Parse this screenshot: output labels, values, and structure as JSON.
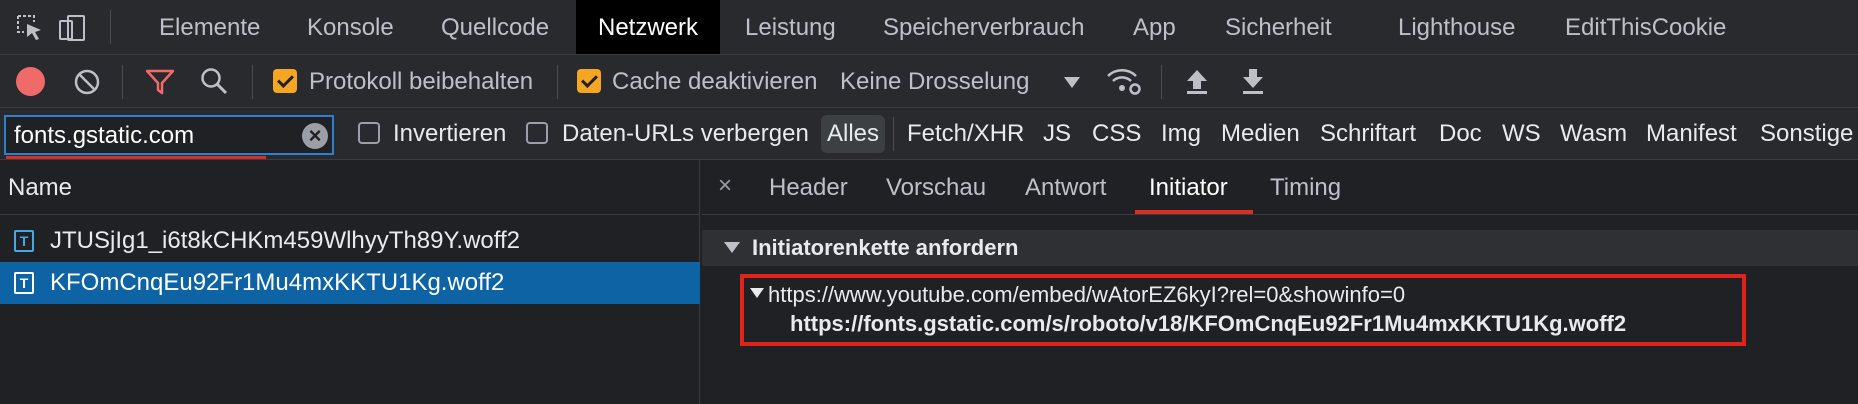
{
  "top_tabs": [
    {
      "label": "Elemente"
    },
    {
      "label": "Konsole"
    },
    {
      "label": "Quellcode"
    },
    {
      "label": "Netzwerk"
    },
    {
      "label": "Leistung"
    },
    {
      "label": "Speicherverbrauch"
    },
    {
      "label": "App"
    },
    {
      "label": "Sicherheit"
    },
    {
      "label": "Lighthouse"
    },
    {
      "label": "EditThisCookie"
    }
  ],
  "toolbar": {
    "preserve_log_label": "Protokoll beibehalten",
    "disable_cache_label": "Cache deaktivieren",
    "throttling_value": "Keine Drosselung"
  },
  "filter": {
    "search_value": "fonts.gstatic.com",
    "invert_label": "Invertieren",
    "hide_data_urls_label": "Daten-URLs verbergen",
    "types": [
      "Alles",
      "Fetch/XHR",
      "JS",
      "CSS",
      "Img",
      "Medien",
      "Schriftart",
      "Doc",
      "WS",
      "Wasm",
      "Manifest",
      "Sonstige"
    ]
  },
  "requests": {
    "header": "Name",
    "rows": [
      {
        "name": "JTUSjIg1_i6t8kCHKm459WlhyyTh89Y.woff2",
        "icon": "T"
      },
      {
        "name": "KFOmCnqEu92Fr1Mu4mxKKTU1Kg.woff2",
        "icon": "T"
      }
    ]
  },
  "details": {
    "tabs": [
      "Header",
      "Vorschau",
      "Antwort",
      "Initiator",
      "Timing"
    ],
    "section_title": "Initiatorenkette anfordern",
    "chain_parent": "https://www.youtube.com/embed/wAtorEZ6kyI?rel=0&showinfo=0",
    "chain_child": "https://fonts.gstatic.com/s/roboto/v18/KFOmCnqEu92Fr1Mu4mxKKTU1Kg.woff2"
  },
  "colors": {
    "accent_blue": "#0e63a4",
    "highlight_red": "#e2231a",
    "checkbox_orange": "#f5a623",
    "record_red": "#f16a6a"
  }
}
